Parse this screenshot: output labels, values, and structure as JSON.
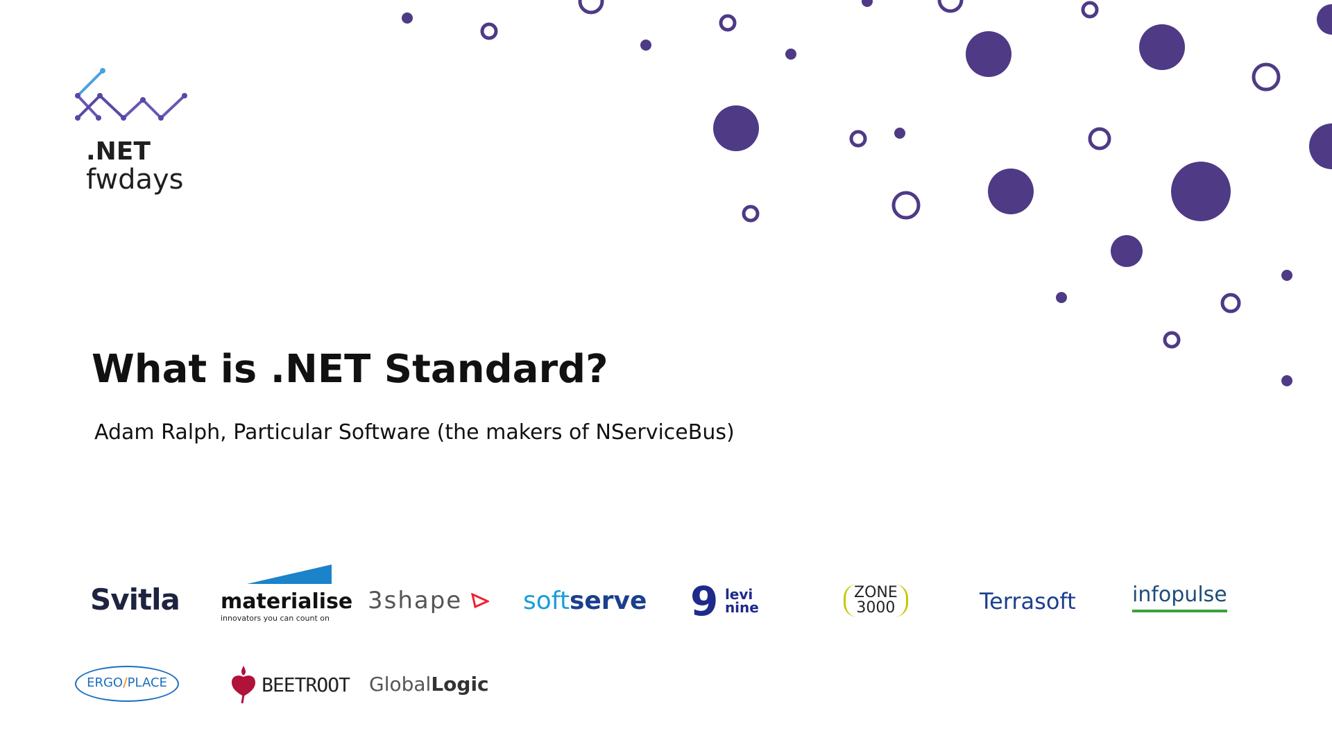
{
  "logo": {
    "line1": ".NET",
    "line2": "fwdays"
  },
  "slide": {
    "title": "What is .NET Standard?",
    "subtitle": "Adam Ralph, Particular Software (the makers of NServiceBus)"
  },
  "sponsors": {
    "svitla": "Svitla",
    "materialise": {
      "name": "materialise",
      "tagline": "innovators you can count on"
    },
    "shape3": "3shape",
    "softserve": {
      "soft": "soft",
      "serve": "serve"
    },
    "levinine": {
      "nine": "9",
      "levi": "levi",
      "nine_word": "nine"
    },
    "zone3000": {
      "line1": "ZONE",
      "line2": "3000"
    },
    "terrasoft": "Terrasoft",
    "infopulse": "infopulse",
    "ergoplace": {
      "ergo": "ERGO",
      "place": "PLACE"
    },
    "beetroot": "BEETROOT",
    "globallogic": {
      "global": "Global",
      "logic": "Logic"
    }
  },
  "colors": {
    "accent": "#4e3a85",
    "title": "#111111"
  }
}
